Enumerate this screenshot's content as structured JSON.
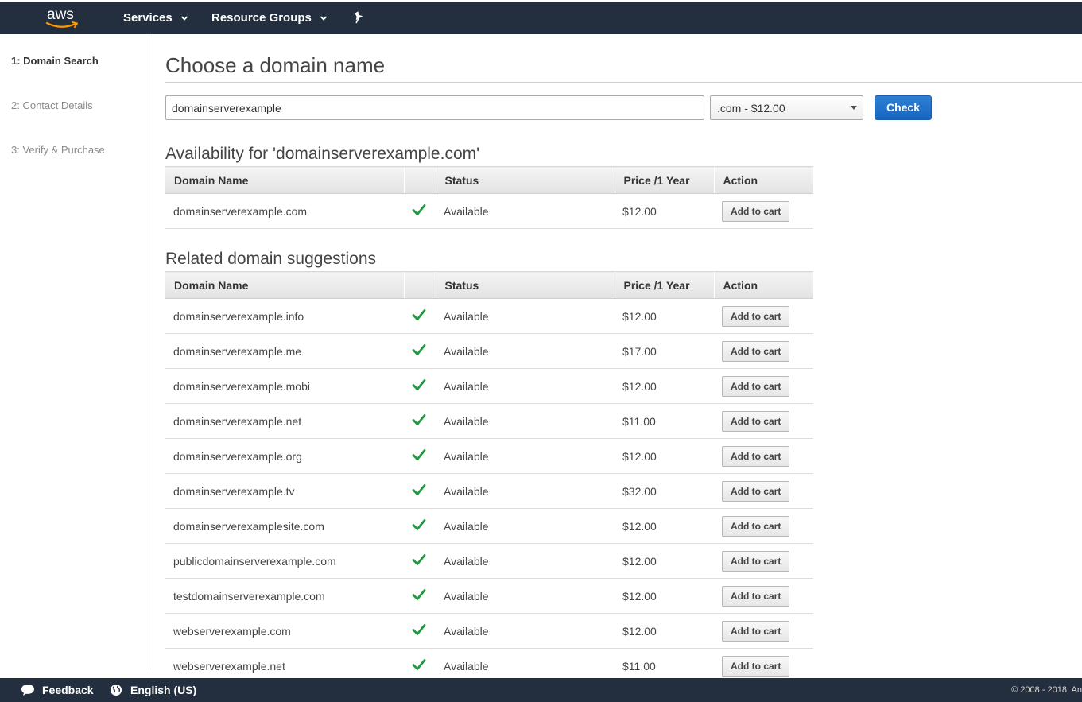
{
  "topnav": {
    "logo": "aws",
    "services_label": "Services",
    "resource_groups_label": "Resource Groups"
  },
  "steps": [
    {
      "label": "1: Domain Search",
      "active": true
    },
    {
      "label": "2: Contact Details",
      "active": false
    },
    {
      "label": "3: Verify & Purchase",
      "active": false
    }
  ],
  "main": {
    "title": "Choose a domain name",
    "search_value": "domainserverexample",
    "tld_selected": ".com - $12.00",
    "check_label": "Check"
  },
  "availability": {
    "heading": "Availability for 'domainserverexample.com'",
    "columns": [
      "Domain Name",
      "",
      "Status",
      "Price /1 Year",
      "Action"
    ],
    "rows": [
      {
        "domain": "domainserverexample.com",
        "status": "Available",
        "price": "$12.00",
        "action": "Add to cart"
      }
    ]
  },
  "suggestions": {
    "heading": "Related domain suggestions",
    "columns": [
      "Domain Name",
      "",
      "Status",
      "Price /1 Year",
      "Action"
    ],
    "rows": [
      {
        "domain": "domainserverexample.info",
        "status": "Available",
        "price": "$12.00",
        "action": "Add to cart"
      },
      {
        "domain": "domainserverexample.me",
        "status": "Available",
        "price": "$17.00",
        "action": "Add to cart"
      },
      {
        "domain": "domainserverexample.mobi",
        "status": "Available",
        "price": "$12.00",
        "action": "Add to cart"
      },
      {
        "domain": "domainserverexample.net",
        "status": "Available",
        "price": "$11.00",
        "action": "Add to cart"
      },
      {
        "domain": "domainserverexample.org",
        "status": "Available",
        "price": "$12.00",
        "action": "Add to cart"
      },
      {
        "domain": "domainserverexample.tv",
        "status": "Available",
        "price": "$32.00",
        "action": "Add to cart"
      },
      {
        "domain": "domainserverexamplesite.com",
        "status": "Available",
        "price": "$12.00",
        "action": "Add to cart"
      },
      {
        "domain": "publicdomainserverexample.com",
        "status": "Available",
        "price": "$12.00",
        "action": "Add to cart"
      },
      {
        "domain": "testdomainserverexample.com",
        "status": "Available",
        "price": "$12.00",
        "action": "Add to cart"
      },
      {
        "domain": "webserverexample.com",
        "status": "Available",
        "price": "$12.00",
        "action": "Add to cart"
      },
      {
        "domain": "webserverexample.net",
        "status": "Available",
        "price": "$11.00",
        "action": "Add to cart"
      }
    ]
  },
  "footer": {
    "feedback_label": "Feedback",
    "language_label": "English (US)",
    "copyright": "© 2008 - 2018, An"
  },
  "colors": {
    "nav_bg": "#232f3e",
    "primary_button": "#1766c0",
    "check_green": "#1d9a3d",
    "aws_orange": "#ff9900"
  },
  "icons": [
    "chevron-down-icon",
    "pin-icon",
    "checkmark-icon",
    "speech-bubble-icon",
    "globe-icon"
  ]
}
